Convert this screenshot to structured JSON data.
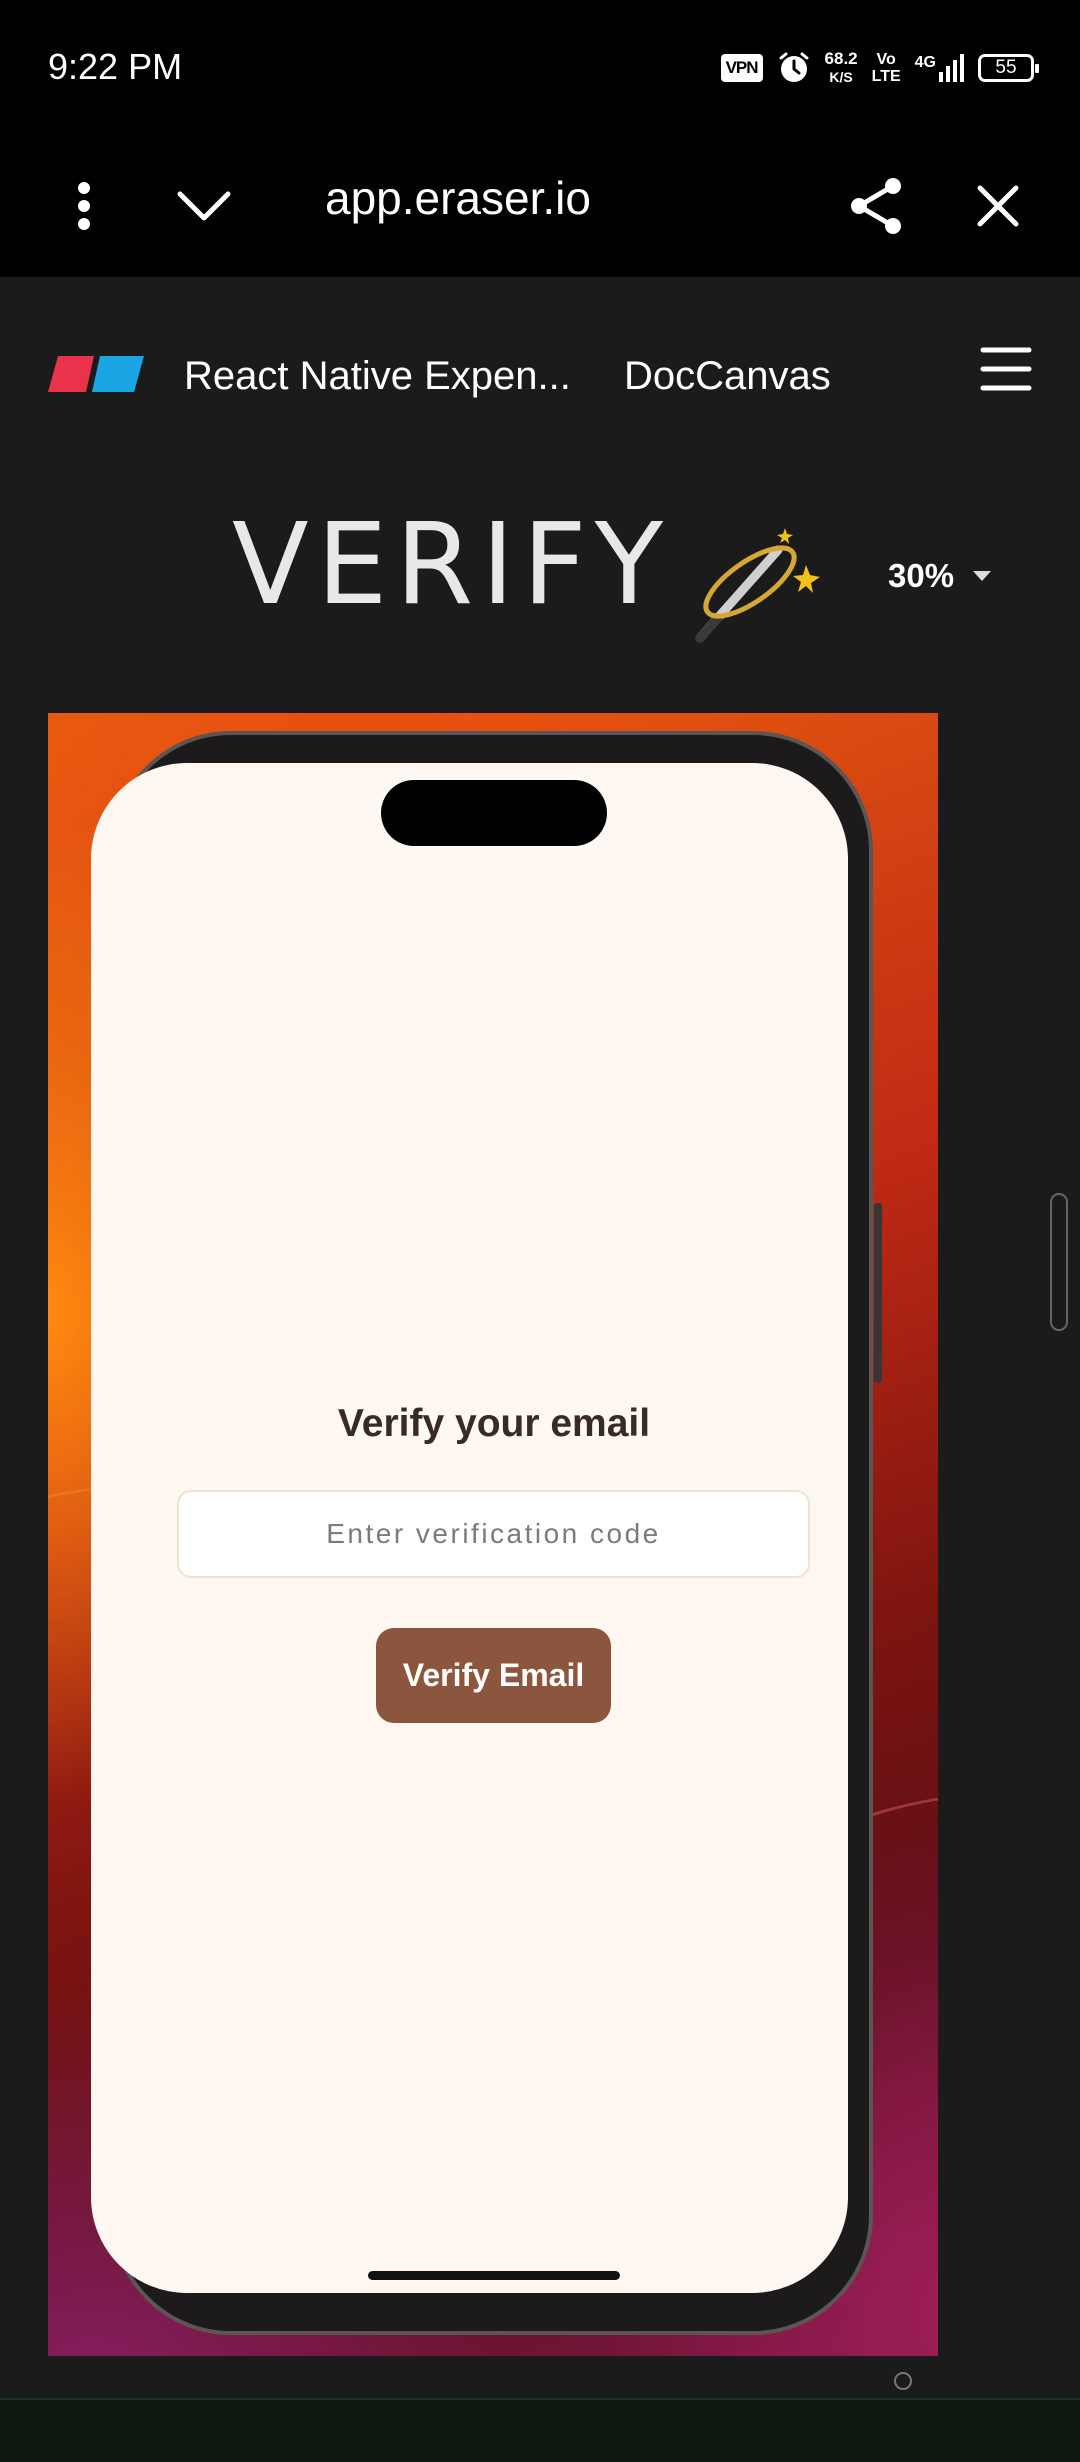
{
  "status_bar": {
    "time": "9:22 PM",
    "vpn": "VPN",
    "speed_value": "68.2",
    "speed_unit": "K/S",
    "volte_top": "Vo",
    "volte_bottom": "LTE",
    "network": "4G",
    "battery": "55"
  },
  "browser": {
    "url": "app.eraser.io",
    "icons": [
      "more-vert-icon",
      "chevron-down-icon",
      "share-icon",
      "close-icon"
    ]
  },
  "eraser": {
    "document_title": "React Native Expen...",
    "tab_label": "DocCanvas",
    "logo_colors": [
      "#e8334a",
      "#1aa6e4"
    ]
  },
  "canvas": {
    "title": "VERIFY",
    "zoom": "30%"
  },
  "phone_screen": {
    "heading": "Verify your email",
    "input_placeholder": "Enter verification code",
    "input_value": "",
    "button_label": "Verify Email",
    "button_color": "#8b553e",
    "background_color": "#fff8f2"
  }
}
